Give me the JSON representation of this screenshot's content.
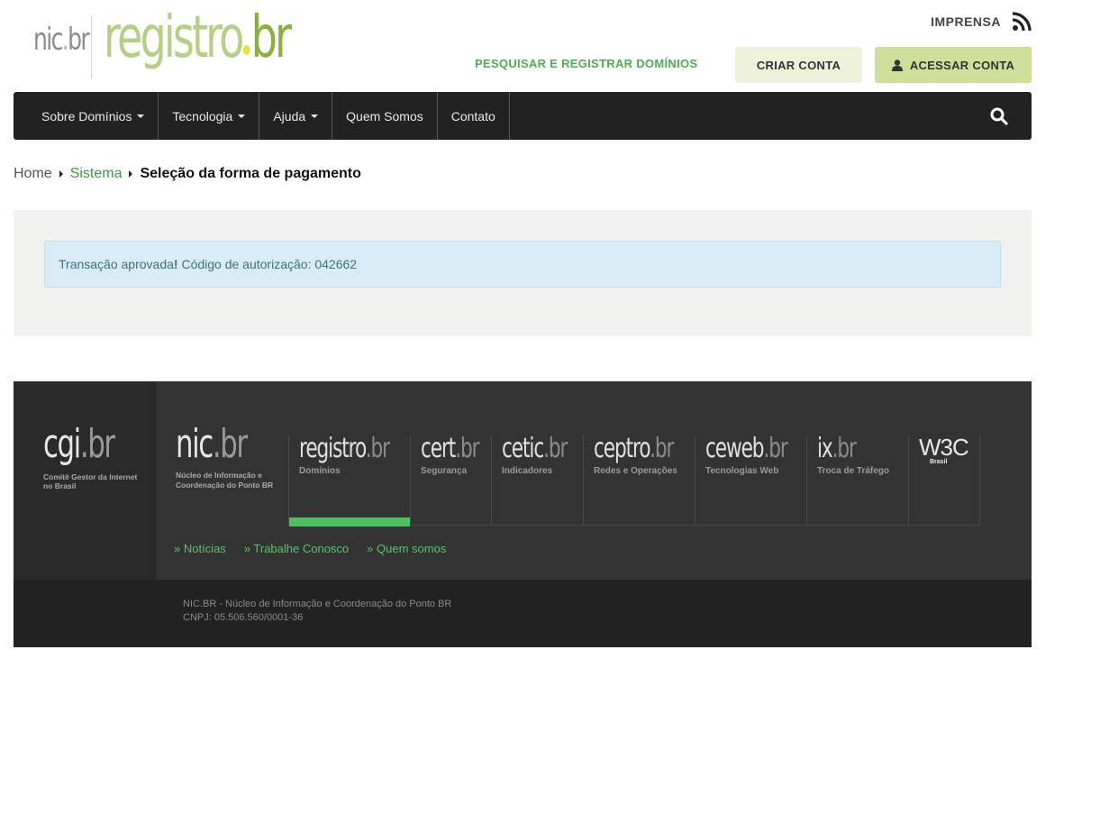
{
  "header": {
    "logo_nic": "nic",
    "logo_nic_suffix": "br",
    "logo_registro": "registro",
    "logo_registro_suffix": "br",
    "imprensa": "IMPRENSA",
    "pesquisar": "PESQUISAR E REGISTRAR DOMÍNIOS",
    "criar_conta": "CRIAR CONTA",
    "acessar_conta": "ACESSAR CONTA",
    "accent_color": "#4caf50"
  },
  "nav": {
    "items": [
      {
        "label": "Sobre Domínios",
        "dropdown": true
      },
      {
        "label": "Tecnologia",
        "dropdown": true
      },
      {
        "label": "Ajuda",
        "dropdown": true
      },
      {
        "label": "Quem Somos",
        "dropdown": false
      },
      {
        "label": "Contato",
        "dropdown": false
      }
    ],
    "search_icon": "search-icon"
  },
  "breadcrumb": {
    "home": "Home",
    "sistema": "Sistema",
    "current": "Seleção da forma de pagamento"
  },
  "alert": {
    "text_prefix": "Transação aprovada",
    "text_bang": "!",
    "text_suffix": " Código de autorização: 042662"
  },
  "footer": {
    "cgi": {
      "name": "cgi",
      "suffix": "br",
      "sub": "Comitê Gestor da Internet no Brasil"
    },
    "nic": {
      "name": "nic",
      "suffix": "br",
      "sub": "Núcleo de Informação e Coordenação do Ponto BR"
    },
    "brands": [
      {
        "name": "registro",
        "suffix": "br",
        "sub": "Domínios",
        "active": true
      },
      {
        "name": "cert",
        "suffix": "br",
        "sub": "Segurança",
        "active": false
      },
      {
        "name": "cetic",
        "suffix": "br",
        "sub": "Indicadores",
        "active": false
      },
      {
        "name": "ceptro",
        "suffix": "br",
        "sub": "Redes e Operações",
        "active": false
      },
      {
        "name": "ceweb",
        "suffix": "br",
        "sub": "Tecnologias Web",
        "active": false
      },
      {
        "name": "ix",
        "suffix": "br",
        "sub": "Troca de Tráfego",
        "active": false
      }
    ],
    "w3c": {
      "name": "W3C",
      "sub": "Brasil"
    },
    "links": [
      "» Notícias",
      "» Trabalhe Conosco",
      "» Quem somos"
    ],
    "info_line1": "NIC.BR - Núcleo de Informação e Coordenação do Ponto BR",
    "info_line2": "CNPJ: 05.506.560/0001-36",
    "active_color": "#4cbf60"
  }
}
